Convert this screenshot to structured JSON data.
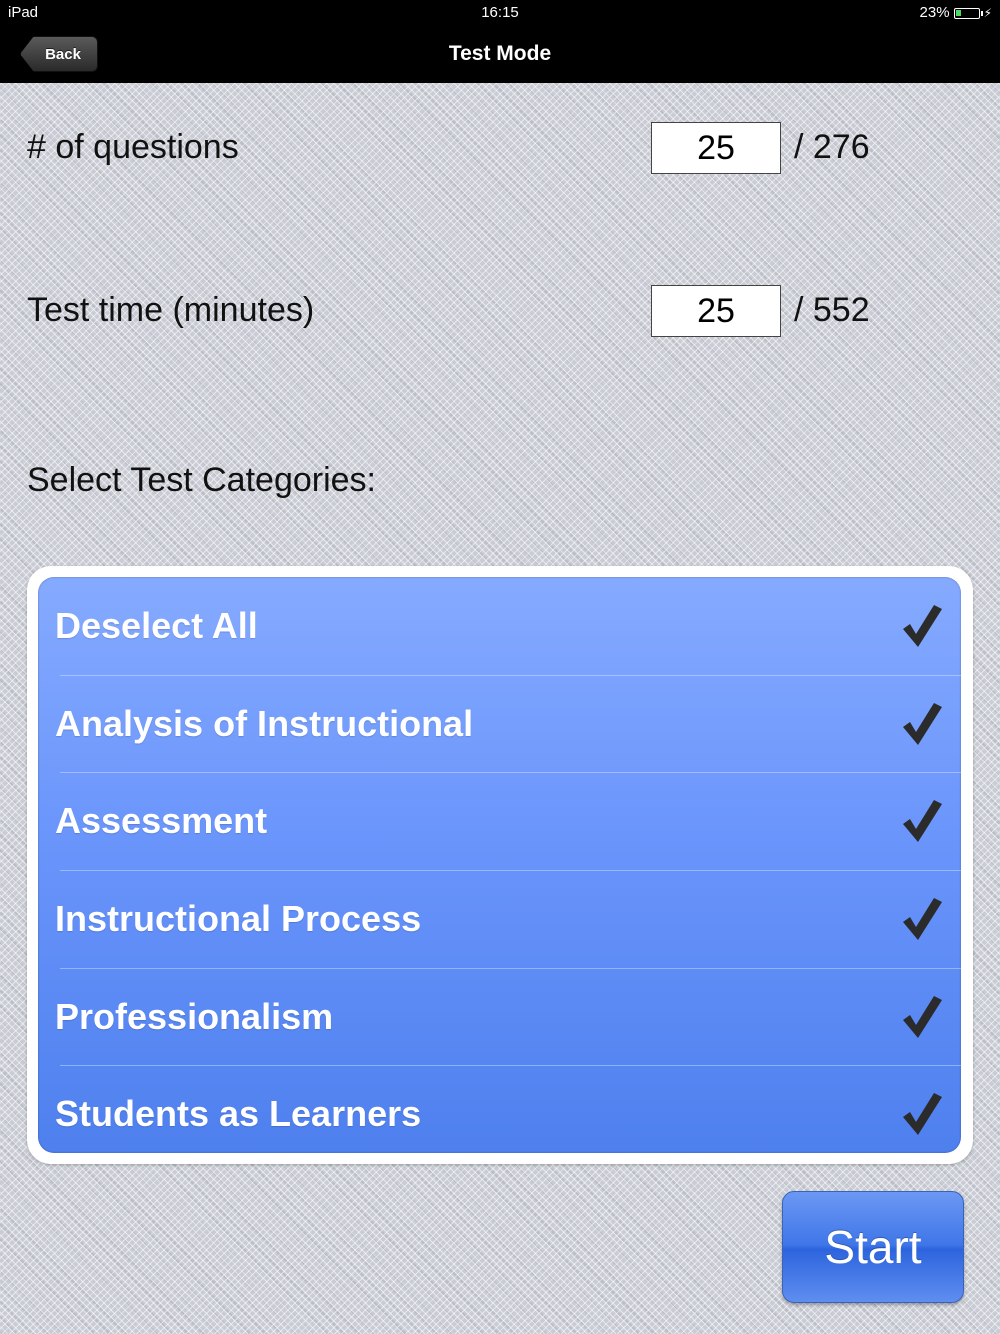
{
  "status_bar": {
    "device": "iPad",
    "time": "16:15",
    "battery_text": "23%",
    "battery_level": 0.23
  },
  "nav_bar": {
    "back_label": "Back",
    "title": "Test Mode"
  },
  "settings": {
    "questions": {
      "label": "# of questions",
      "value": "25",
      "max": "/ 276"
    },
    "time": {
      "label": "Test time (minutes)",
      "value": "25",
      "max": "/ 552"
    }
  },
  "categories": {
    "heading": "Select Test Categories:",
    "items": [
      {
        "label": "Deselect All",
        "checked": true
      },
      {
        "label": "Analysis of Instructional",
        "checked": true
      },
      {
        "label": "Assessment",
        "checked": true
      },
      {
        "label": "Instructional Process",
        "checked": true
      },
      {
        "label": "Professionalism",
        "checked": true
      },
      {
        "label": "Students as Learners",
        "checked": true
      }
    ]
  },
  "actions": {
    "start_label": "Start"
  },
  "colors": {
    "accent": "#4e80ee",
    "check": "#2b2b2b"
  }
}
